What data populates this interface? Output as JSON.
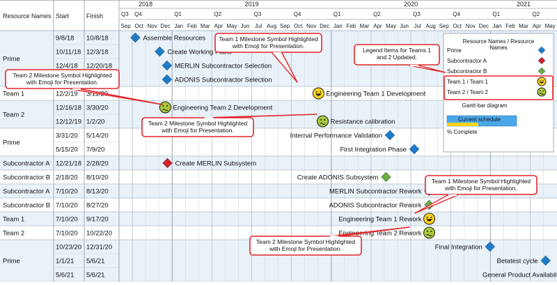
{
  "table": {
    "col_headers": {
      "resource": "Resource Names",
      "start": "Start",
      "finish": "Finish"
    },
    "rows": [
      {
        "resource": "Prime",
        "start": "9/8/18",
        "finish": "10/8/18",
        "task": "Assemble Resources",
        "marker": "diamond-blue",
        "d": "2018-10-08"
      },
      {
        "resource": "",
        "start": "10/11/18",
        "finish": "12/3/18",
        "task": "Create Working Plans",
        "marker": "diamond-blue",
        "d": "2018-12-03"
      },
      {
        "resource": "",
        "start": "12/4/18",
        "finish": "12/20/18",
        "task": "MERLIN Subcontractor Selection",
        "marker": "diamond-blue",
        "d": "2018-12-20"
      },
      {
        "resource": "",
        "start": "",
        "finish": "",
        "task": "ADONIS Subcontractor Selection",
        "marker": "diamond-blue",
        "d": "2018-12-20"
      },
      {
        "resource": "Team 1",
        "start": "12/2/19",
        "finish": "3/11/20",
        "task": "Engineering Team 1 Development",
        "marker": "smiley-happy",
        "d": "2019-12-02"
      },
      {
        "resource": "Team 2",
        "start": "12/16/18",
        "finish": "3/30/20",
        "task": "Engineering Team 2 Development",
        "marker": "smiley-sick",
        "d": "2018-12-16"
      },
      {
        "resource": "",
        "start": "12/12/19",
        "finish": "1/2/20",
        "task": "Resistance calibration",
        "marker": "smiley-sick",
        "d": "2019-12-12"
      },
      {
        "resource": "Prime",
        "start": "3/31/20",
        "finish": "5/14/20",
        "task": "Internal Performance Validation",
        "marker": "diamond-blue",
        "d": "2020-05-14"
      },
      {
        "resource": "",
        "start": "5/15/20",
        "finish": "7/9/20",
        "task": "First Integration Phase",
        "marker": "diamond-blue",
        "d": "2020-07-09"
      },
      {
        "resource": "Subcontractor A",
        "start": "12/21/18",
        "finish": "2/28/20",
        "task": "Create MERLIN Subsystem",
        "marker": "diamond-red",
        "d": "2018-12-21"
      },
      {
        "resource": "Subcontractor B",
        "start": "2/18/20",
        "finish": "8/10/20",
        "task": "Create ADONIS Subsystem",
        "marker": "diamond-green",
        "d": "2020-05-05"
      },
      {
        "resource": "Subcontractor A",
        "start": "7/10/20",
        "finish": "8/13/20",
        "task": "MERLIN Subcontractor Rework",
        "marker": "diamond-red",
        "d": "2020-08-13"
      },
      {
        "resource": "Subcontractor B",
        "start": "7/10/20",
        "finish": "8/27/20",
        "task": "ADONIS Subcontractor Rework",
        "marker": "diamond-green",
        "d": "2020-08-13"
      },
      {
        "resource": "Team 1",
        "start": "7/10/20",
        "finish": "9/17/20",
        "task": "Engineering Team 1 Rework",
        "marker": "smiley-happy",
        "d": "2020-08-13"
      },
      {
        "resource": "Team 2",
        "start": "7/10/20",
        "finish": "10/22/20",
        "task": "Engineering Team 2 Rework",
        "marker": "smiley-sick",
        "d": "2020-08-13"
      },
      {
        "resource": "Prime",
        "start": "10/23/20",
        "finish": "12/31/20",
        "task": "Final Integration",
        "marker": "diamond-blue",
        "d": "2020-12-31"
      },
      {
        "resource": "",
        "start": "1/1/21",
        "finish": "5/6/21",
        "task": "Betatest cycle",
        "marker": "diamond-blue",
        "d": "2021-05-06"
      },
      {
        "resource": "",
        "start": "5/6/21",
        "finish": "5/6/21",
        "task": "General Product Availability",
        "marker": "diamond-blue",
        "d": "2021-07-03"
      }
    ]
  },
  "timeline": {
    "years": [
      "2018",
      "2019",
      "2020",
      "2021"
    ],
    "quarters": [
      "Q3",
      "Q4",
      "Q1",
      "Q2",
      "Q3",
      "Q4",
      "Q1",
      "Q2",
      "Q3",
      "Q4",
      "Q1",
      "Q2"
    ],
    "months": [
      "Sep",
      "Oct",
      "Nov",
      "Dec",
      "Jan",
      "Feb",
      "Mar",
      "Apr",
      "May",
      "Jun",
      "Jul",
      "Aug",
      "Sep",
      "Oct",
      "Nov",
      "Dec",
      "Jan",
      "Feb",
      "Mar",
      "Apr",
      "May",
      "Jun",
      "Jul",
      "Aug",
      "Sep",
      "Oct",
      "Nov",
      "Dec",
      "Jan",
      "Feb",
      "Mar",
      "Apr",
      "May"
    ]
  },
  "legend": {
    "title": "Resource Names / Resource",
    "title_cont": "Names",
    "items": [
      {
        "label": "Prime",
        "marker": "diamond-blue"
      },
      {
        "label": "Subcontractor A",
        "marker": "diamond-red"
      },
      {
        "label": "Subcontractor B",
        "marker": "diamond-green"
      },
      {
        "label": "Team 1 / Team 1",
        "marker": "smiley-happy"
      },
      {
        "label": "Team 2 / Team 2",
        "marker": "smiley-sick"
      }
    ],
    "gantt_title": "Gantt-bar diagram",
    "current_schedule": "Current schedule",
    "percent_complete": "% Complete",
    "percent_fill": 0.45
  },
  "callouts": [
    {
      "lines": [
        "Team 1 Milestone Symbol Highlighted",
        "with Emoji for Presentation."
      ]
    },
    {
      "lines": [
        "Legend Items for Teams 1",
        "and 2 Updated."
      ]
    },
    {
      "lines": [
        "Team 2 Milestone Symbol Highlighted",
        "with Emoji for Presentation."
      ]
    },
    {
      "lines": [
        "Team 2 Milestone Symbol Highlighted",
        "with Emoji for Presentation."
      ]
    },
    {
      "lines": [
        "Team 1 Milestone Symbol Highlighted",
        "with Emoji for Presentation."
      ]
    },
    {
      "lines": [
        "Team 2 Milestone Symbol Highlighted",
        "with Emoji for Presentation."
      ]
    }
  ],
  "colors": {
    "blue": "#1f7bc6",
    "red": "#d42028",
    "green": "#6aab3b",
    "smiley_happy": "#ffd21a",
    "smiley_sick": "#a8c83a",
    "callout_border": "#e2252b",
    "row_band": "#e9f1f9",
    "schedule_bar": "#4aa8ea",
    "complete_bar": "#ffd21a"
  }
}
